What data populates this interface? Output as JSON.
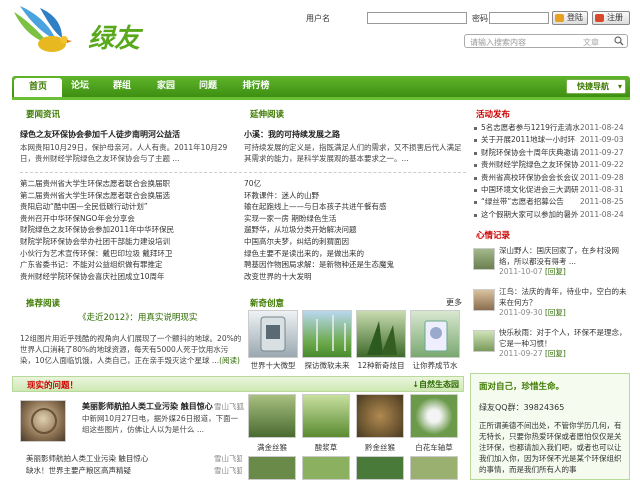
{
  "brand": {
    "logo_text": "绿友"
  },
  "login": {
    "username_label": "用户名",
    "password_label": "密码",
    "login_button": "登陆",
    "register_button": "注册"
  },
  "search": {
    "placeholder": "请输入搜索内容",
    "scope": "文章"
  },
  "nav": {
    "items": [
      "首页",
      "论坛",
      "群组",
      "家园",
      "问题",
      "排行榜"
    ],
    "quick_nav": "快捷导航"
  },
  "news": {
    "title": "要闻资讯",
    "headline": "绿色之友环保协会参加千人徒步南明河公益活",
    "summary": "本网贵阳10月29日，保护母亲河，人人有责。2011年10月29日，贵州财经学院绿色之友环保协会与了主题 ...",
    "items": [
      "第二届贵州省大学生环保志愿者联合会换届职",
      "第二届贵州省大学生环保志愿者联合会换届选",
      "贵阳启动“酷中国—全民低碳行动计划”",
      "贵州召开中华环保NGO年会分享会",
      "财院绿色之友环保协会参加2011年中华环保民",
      "财院学院环保协会举办社团干部能力建设培训",
      "小伙行为艺术宣传环保：戴巴印垃圾 戴拜环卫",
      "广东省委书记：不能对公益组织做有罪推定",
      "贵州财经学院环保协会喜庆社团成立10周年"
    ]
  },
  "extended": {
    "title": "延伸阅读",
    "headline": "小溪：我的可持续发展之路",
    "summary": "可持续发展的定义是，指既满足人们的需求，又不损害后代人满足其需求的能力，是科学发展观的基本要求之一。...",
    "items": [
      "70亿",
      "环教课件：迷人的山野",
      "输在起跑线上——与日本孩子共进午餐有感",
      "实现一家一房 期盼绿色生活",
      "遛野华，从垃圾分类开始解决问题",
      "中国高尔夫梦，纠结的刺猬面因",
      "绿色主要不是读出来的，是做出来的",
      "聘基因作物困局求解：是新物种还是生态魔鬼",
      "改变世界的十大发明"
    ]
  },
  "activity": {
    "title": "活动发布",
    "items": [
      {
        "title": "5名志愿者参与1219行走清水",
        "date": "2011-08-24"
      },
      {
        "title": "关于开展2011地球一小时环",
        "date": "2011-09-03"
      },
      {
        "title": "财院环保协会十周年庆典邀请",
        "date": "2011-09-27"
      },
      {
        "title": "贵州财经学院绿色之友环保协",
        "date": "2011-09-22"
      },
      {
        "title": "贵州省高校环保协会会长会议",
        "date": "2011-09-28"
      },
      {
        "title": "中国环境文化促进会三大调研",
        "date": "2011-08-31"
      },
      {
        "title": "“绿丝带”志愿者招募公告",
        "date": "2011-08-25"
      },
      {
        "title": "这个假期大家可以参加的暑外",
        "date": "2011-08-24"
      }
    ]
  },
  "heart": {
    "title": "心情记录",
    "entries": [
      {
        "text": "深山野人：国庆回家了，在乡村没网络，所以都没有得考 ...",
        "date": "2011-10-07",
        "reply": "[回复]"
      },
      {
        "text": "江鸟：法庆的青年，待业中，空白的未来在何方？",
        "date": "2011-09-30",
        "reply": "[回复]"
      },
      {
        "text": "快乐秋雨：对于个人，环保不是理念，它是一种习惯！",
        "date": "2011-09-27",
        "reply": "[回复]"
      }
    ]
  },
  "recommend": {
    "title": "推荐阅读",
    "headline": "《走近2012》：用真实说明现实",
    "summary": "12组图片用近乎残酷的视角向人们展现了一个颤抖的地球。20%的世界人口消耗了80%的地球资源，每天有5000人死于饮用水污染，10亿人面临饥饿，人类自己，正在亲手毁灭这个星球 ...",
    "more": "(阅读)"
  },
  "new_creative": {
    "title": "新奇创意",
    "more": "更多",
    "items": [
      "世界十大微型",
      "探访微软未来",
      "12种新奇炫目",
      "让你养成节水"
    ]
  },
  "problem": {
    "title": "现实的问题！",
    "more": "↓自然生态园",
    "headline": "美丽影师航拍人类工业污染 触目惊心",
    "author": "雪山飞狐",
    "summary": "中新网10月27日电，据外媒26日报道，下面一组这些图片，仿佛让人以为是什么 ...",
    "items": [
      {
        "title": "美丽影师航拍人类工业污染 触目惊心",
        "author": "雪山飞狐"
      },
      {
        "title": "缺水！世界主要产粮区高声精疑",
        "author": "雪山飞狐"
      }
    ]
  },
  "nature": {
    "items": [
      "满金丝猴",
      "酸浆草",
      "黔金丝猴",
      "白花车轴草"
    ]
  },
  "face": {
    "title": "面对自己，珍惜生命。",
    "qq": "绿友QQ群：39824365",
    "text": "正所谓美德不间出处，不管你学历几何，有无特长，只要你热爱环保或者愿怕仅仅是关注环保，也都请加入我们吧，或者也可以让我们加入你，因为环保不光是某个环保组织的事情，而是我们所有人的事"
  },
  "colors": {
    "accent": "#4a9a1a",
    "red": "#c00000",
    "nav": "#4fa41f"
  }
}
